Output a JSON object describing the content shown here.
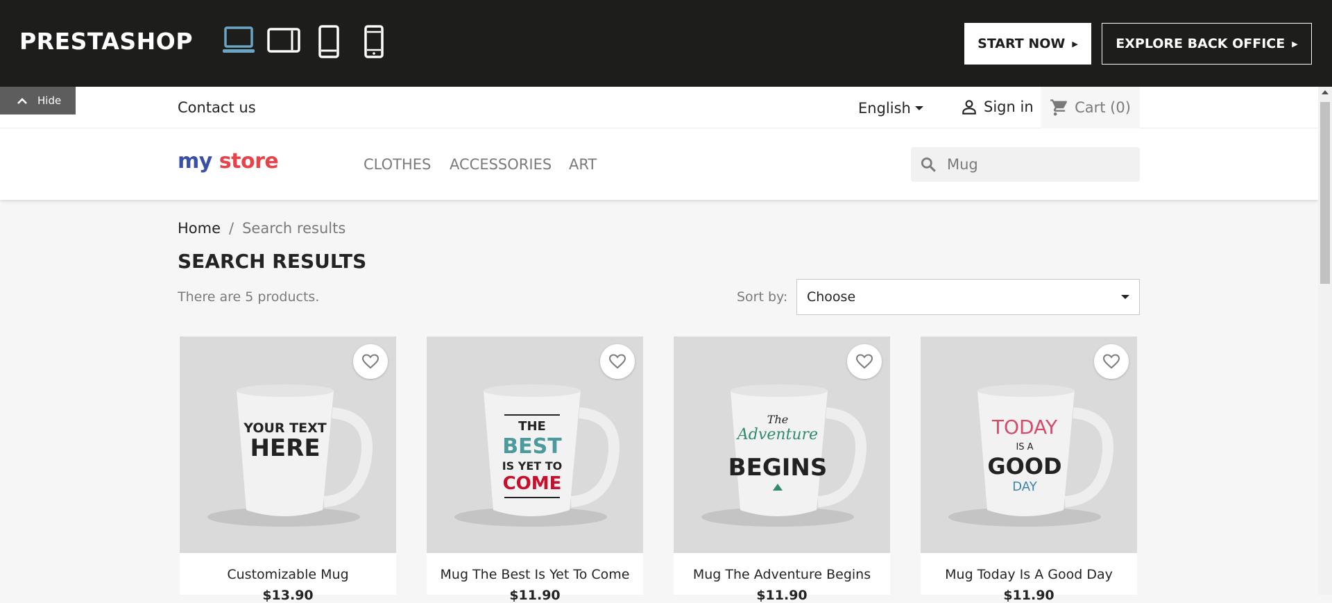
{
  "demo_bar": {
    "brand": "PRESTASHOP",
    "devices": [
      "desktop-icon",
      "tablet-landscape-icon",
      "tablet-portrait-icon",
      "mobile-icon"
    ],
    "active_device_color": "#6aa6c4",
    "start_now": "START NOW",
    "explore": "EXPLORE BACK OFFICE"
  },
  "hide_tab": {
    "label": "Hide"
  },
  "nav": {
    "contact": "Contact us",
    "language": "English",
    "sign_in": "Sign in",
    "cart": "Cart (0)"
  },
  "logo": {
    "part1": "my",
    "part2": "store"
  },
  "menu": [
    {
      "label": "CLOTHES"
    },
    {
      "label": "ACCESSORIES"
    },
    {
      "label": "ART"
    }
  ],
  "search": {
    "value": "Mug"
  },
  "breadcrumb": {
    "home": "Home",
    "separator": "/",
    "current": "Search results"
  },
  "page": {
    "title": "SEARCH RESULTS",
    "count": "There are 5 products.",
    "sort_label": "Sort by:",
    "sort_value": "Choose"
  },
  "products": [
    {
      "name": "Customizable Mug",
      "price": "$13.90",
      "mug_text": [
        "YOUR TEXT",
        "HERE"
      ]
    },
    {
      "name": "Mug The Best Is Yet To Come",
      "price": "$11.90",
      "mug_text": [
        "THE",
        "BEST",
        "IS YET TO",
        "COME"
      ]
    },
    {
      "name": "Mug The Adventure Begins",
      "price": "$11.90",
      "mug_text": [
        "The",
        "Adventure",
        "BEGINS"
      ]
    },
    {
      "name": "Mug Today Is A Good Day",
      "price": "$11.90",
      "mug_text": [
        "TODAY",
        "IS A",
        "GOOD",
        "DAY"
      ]
    }
  ],
  "colors": {
    "topbar": "#1d1d1b",
    "accent_blue": "#6aa6c4",
    "page_bg": "#f6f6f6"
  }
}
